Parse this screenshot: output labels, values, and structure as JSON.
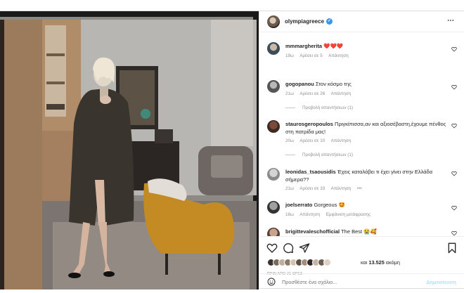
{
  "header": {
    "username": "olympiagreece",
    "verified_mark": "✓",
    "more_icon": "⋯"
  },
  "comments": [
    {
      "username": "mmmargherita",
      "text": "❤️❤️❤️",
      "meta": [
        "19ω",
        "Αρέσει σε 5",
        "Απάντηση"
      ]
    },
    {
      "username": "gogopanou",
      "text": "Στον κόσμο της",
      "meta": [
        "21ω",
        "Αρέσει σε 26",
        "Απάντηση"
      ],
      "view_replies": "Προβολή απαντήσεων (1)"
    },
    {
      "username": "stauros_geropoulos",
      "display_username": "staurosgeropoulos",
      "text": "Πριγκίπισσα,αν και αξιοσέβαστη,έχουμε πένθος στη πατρίδα μας!",
      "meta": [
        "20ω",
        "Αρέσει σε 10",
        "Απάντηση"
      ],
      "view_replies": "Προβολή απαντήσεων (1)"
    },
    {
      "username": "leonidas_tsaousidis",
      "text": "Έχεις καταλάβει τι έχει γίνει στην Ελλάδα σήμερα??",
      "meta": [
        "21ω",
        "Αρέσει σε 33",
        "Απάντηση",
        "•••"
      ]
    },
    {
      "username": "joelserrato",
      "text": "Gorgeous 🤩",
      "meta": [
        "18ω",
        "Απάντηση",
        "Εμφάνιση μετάφρασης"
      ]
    },
    {
      "username": "brigittevaleschofficial",
      "text": "The Best 😭🥰"
    }
  ],
  "likes": {
    "text_prefix": "και ",
    "count": "13.525",
    "text_suffix": " ακόμη"
  },
  "time_ago": "ΠΡΙΝ ΑΠΟ 21 ΩΡΕΣ",
  "add_comment": {
    "placeholder": "Προσθέστε ένα σχόλιο...",
    "post_label": "Δημοσίευση"
  },
  "icons": [
    "heart-icon",
    "comment-icon",
    "share-icon",
    "bookmark-icon",
    "emoji-icon",
    "more-icon",
    "verified-icon"
  ]
}
